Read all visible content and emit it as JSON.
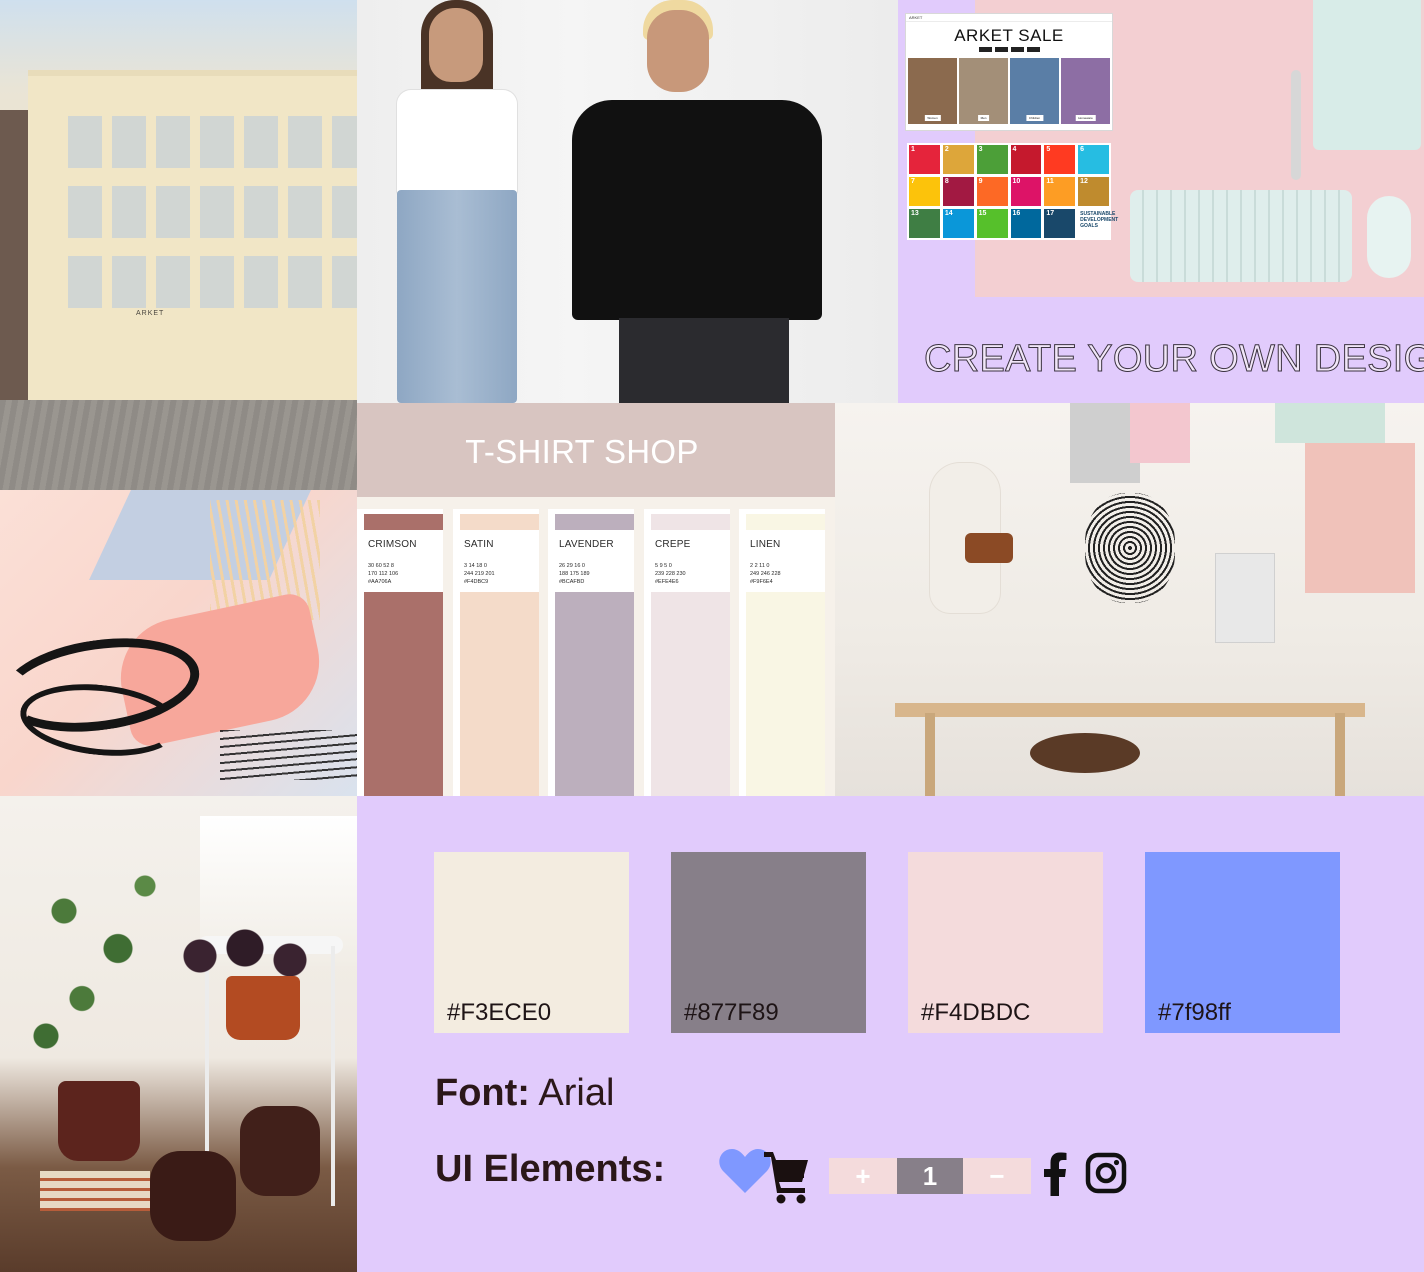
{
  "building": {
    "sign": "ARKET"
  },
  "create_panel": {
    "website": {
      "nav_brand": "ARKET",
      "title": "ARKET SALE",
      "thumbs": [
        "Women",
        "Men",
        "Children",
        "Homeware"
      ]
    },
    "sdg_numbers": [
      "1",
      "2",
      "3",
      "4",
      "5",
      "6",
      "7",
      "8",
      "9",
      "10",
      "11",
      "12",
      "13",
      "14",
      "15",
      "16",
      "17",
      ""
    ],
    "sdg_colors": [
      "#e5243b",
      "#dda63a",
      "#4c9f38",
      "#c5192d",
      "#ff3a21",
      "#26bde2",
      "#fcc30b",
      "#a21942",
      "#fd6925",
      "#dd1367",
      "#fd9d24",
      "#bf8b2e",
      "#3f7e44",
      "#0a97d9",
      "#56c02b",
      "#00689d",
      "#19486a",
      "#ffffff"
    ],
    "sdg_goals_label": "SUSTAINABLE DEVELOPMENT GOALS",
    "title": "CREATE YOUR OWN DESIGN"
  },
  "shop": {
    "title": "T-SHIRT SHOP",
    "swatches": [
      {
        "name": "CRIMSON",
        "cmyk": "30 60 52 8",
        "rgb": "170 112 106",
        "hex": "#AA706A",
        "color": "#aa706a"
      },
      {
        "name": "SATIN",
        "cmyk": "3 14 18 0",
        "rgb": "244 219 201",
        "hex": "#F4DBC9",
        "color": "#f4dbc9"
      },
      {
        "name": "LAVENDER",
        "cmyk": "26 29 16 0",
        "rgb": "188 175 189",
        "hex": "#BCAFBD",
        "color": "#bcafbd"
      },
      {
        "name": "CREPE",
        "cmyk": "5 9 5 0",
        "rgb": "239 228 230",
        "hex": "#EFE4E6",
        "color": "#efe4e6"
      },
      {
        "name": "LINEN",
        "cmyk": "2 2 11 0",
        "rgb": "249 246 228",
        "hex": "#F9F6E4",
        "color": "#f9f6e4"
      }
    ]
  },
  "guide": {
    "colors": [
      {
        "hex": "#F3ECE0",
        "color": "#f3ece0"
      },
      {
        "hex": "#877F89",
        "color": "#877f89"
      },
      {
        "hex": "#F4DBDC",
        "color": "#f4dbdc"
      },
      {
        "hex": "#7f98ff",
        "color": "#7f98ff"
      }
    ],
    "font_label": "Font:",
    "font_value": "Arial",
    "ui_label": "UI Elements:",
    "stepper": {
      "plus": "+",
      "value": "1",
      "minus": "−"
    },
    "icons": [
      "heart-icon",
      "cart-icon",
      "facebook-icon",
      "instagram-icon"
    ]
  }
}
